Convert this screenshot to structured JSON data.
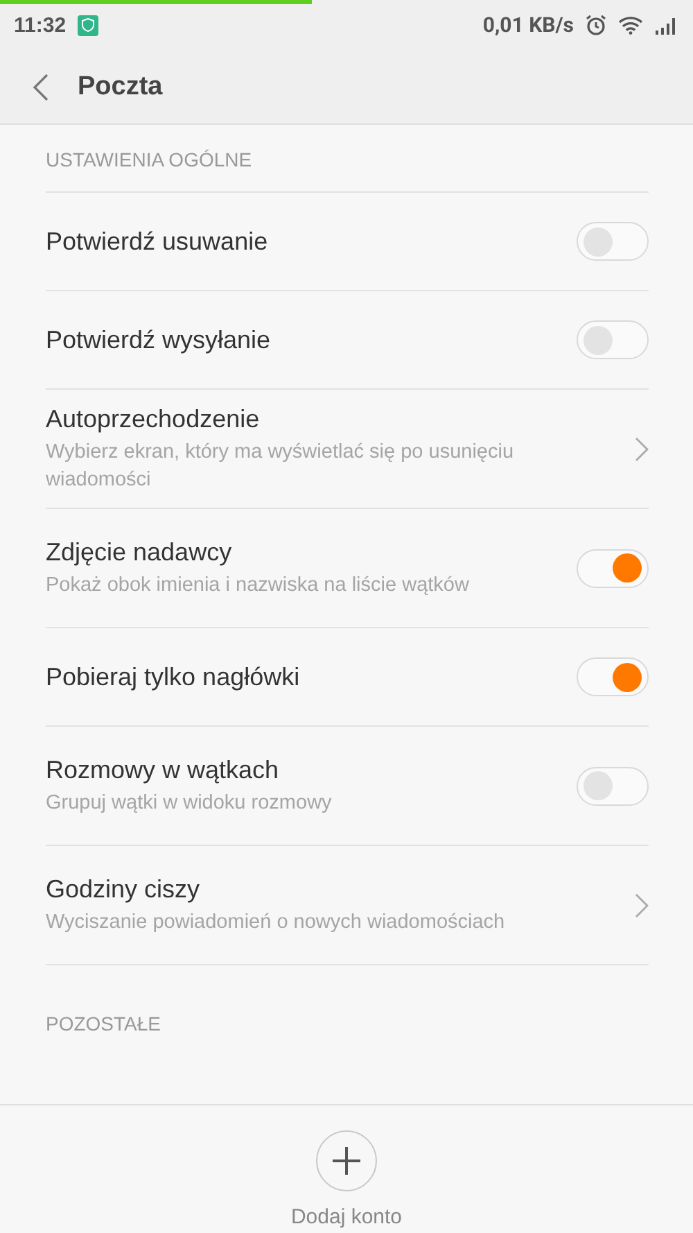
{
  "status_bar": {
    "time": "11:32",
    "speed": "0,01 KB/s",
    "progress": {
      "level": 0.45
    }
  },
  "header": {
    "title": "Poczta"
  },
  "sections": [
    {
      "title": "USTAWIENIA OGÓLNE",
      "items": [
        {
          "kind": "toggle",
          "title": "Potwierdź usuwanie",
          "on": false
        },
        {
          "kind": "toggle",
          "title": "Potwierdź wysyłanie",
          "on": false
        },
        {
          "kind": "link",
          "title": "Autoprzechodzenie",
          "summary": "Wybierz ekran, który ma wyświetlać się po usunięciu wiadomości"
        },
        {
          "kind": "toggle",
          "title": "Zdjęcie nadawcy",
          "summary": "Pokaż obok imienia i nazwiska na liście wątków",
          "on": true
        },
        {
          "kind": "toggle",
          "title": "Pobieraj tylko nagłówki",
          "on": true
        },
        {
          "kind": "toggle",
          "title": "Rozmowy w wątkach",
          "summary": "Grupuj wątki w widoku rozmowy",
          "on": false
        },
        {
          "kind": "link",
          "title": "Godziny ciszy",
          "summary": "Wyciszanie powiadomień o nowych wiadomościach"
        }
      ]
    },
    {
      "title": "POZOSTAŁE"
    }
  ],
  "footer": {
    "action": "Dodaj konto"
  }
}
